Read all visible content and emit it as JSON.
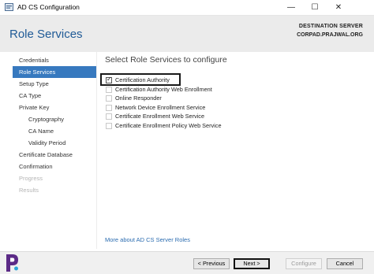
{
  "window": {
    "title": "AD CS Configuration",
    "minimize": "—",
    "maximize": "☐",
    "close": "✕"
  },
  "header": {
    "page_title": "Role Services",
    "destination_label": "DESTINATION SERVER",
    "destination_server": "CORPAD.PRAJWAL.ORG"
  },
  "nav": {
    "items": [
      {
        "label": "Credentials",
        "state": "normal",
        "level": 0
      },
      {
        "label": "Role Services",
        "state": "active",
        "level": 0
      },
      {
        "label": "Setup Type",
        "state": "normal",
        "level": 0
      },
      {
        "label": "CA Type",
        "state": "normal",
        "level": 0
      },
      {
        "label": "Private Key",
        "state": "normal",
        "level": 0
      },
      {
        "label": "Cryptography",
        "state": "normal",
        "level": 1
      },
      {
        "label": "CA Name",
        "state": "normal",
        "level": 1
      },
      {
        "label": "Validity Period",
        "state": "normal",
        "level": 1
      },
      {
        "label": "Certificate Database",
        "state": "normal",
        "level": 0
      },
      {
        "label": "Confirmation",
        "state": "normal",
        "level": 0
      },
      {
        "label": "Progress",
        "state": "disabled",
        "level": 0
      },
      {
        "label": "Results",
        "state": "disabled",
        "level": 0
      }
    ]
  },
  "main": {
    "heading": "Select Role Services to configure",
    "roles": [
      {
        "label": "Certification Authority",
        "checked": true
      },
      {
        "label": "Certification Authority Web Enrollment",
        "checked": false
      },
      {
        "label": "Online Responder",
        "checked": false
      },
      {
        "label": "Network Device Enrollment Service",
        "checked": false
      },
      {
        "label": "Certificate Enrollment Web Service",
        "checked": false
      },
      {
        "label": "Certificate Enrollment Policy Web Service",
        "checked": false
      }
    ],
    "more_link": "More about AD CS Server Roles"
  },
  "footer": {
    "previous": "< Previous",
    "next": "Next >",
    "configure": "Configure",
    "cancel": "Cancel"
  },
  "colors": {
    "accent": "#3779bf",
    "title_blue": "#1f5a96",
    "link": "#2b6cb0",
    "logo_purple": "#5b2a86"
  }
}
